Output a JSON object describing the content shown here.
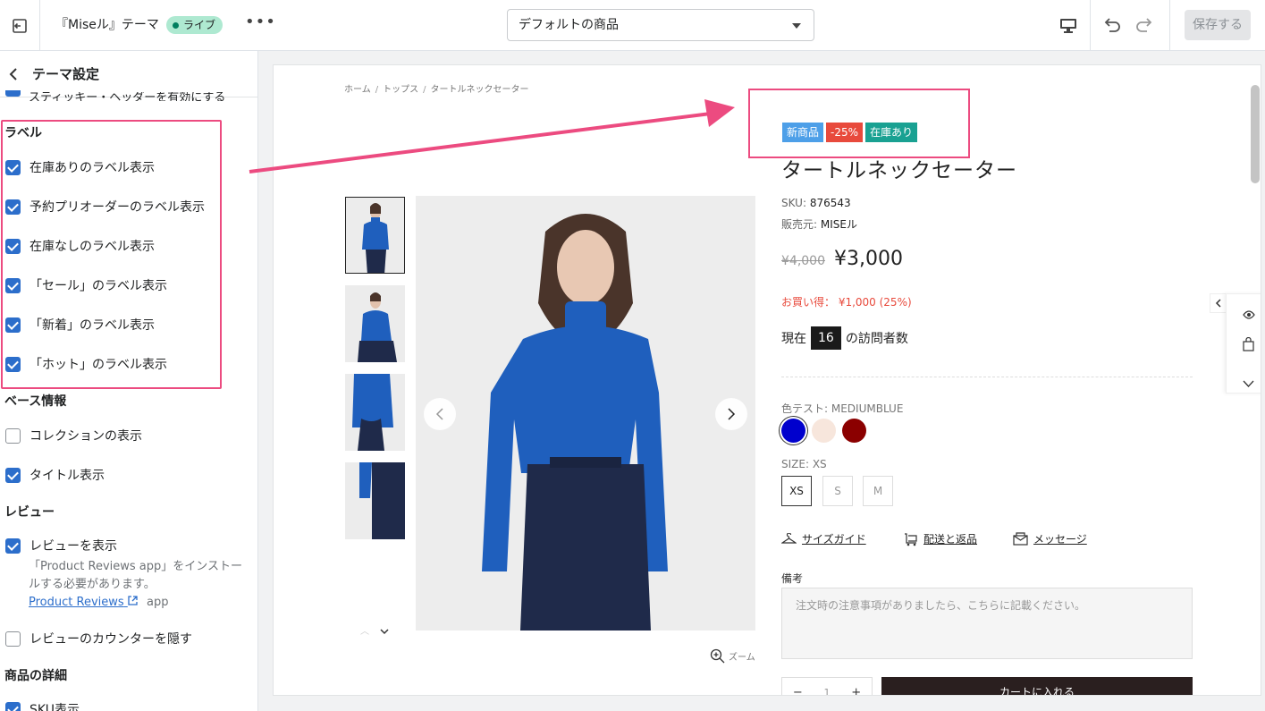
{
  "topbar": {
    "title": "『Miseル』テーマ",
    "badge": "ライブ",
    "more": "•••",
    "template_select": "デフォルトの商品",
    "save_label": "保存する"
  },
  "sidebar": {
    "title": "テーマ設定",
    "clipped_label": "スティッキー・ヘッダーを有効にする",
    "sections": {
      "label": {
        "title": "ラベル",
        "items": [
          "在庫ありのラベル表示",
          "予約プリオーダーのラベル表示",
          "在庫なしのラベル表示",
          "「セール」のラベル表示",
          "「新着」のラベル表示",
          "「ホット」のラベル表示"
        ]
      },
      "base": {
        "title": "ベース情報",
        "items": [
          "コレクションの表示",
          "タイトル表示"
        ]
      },
      "review": {
        "title": "レビュー",
        "items": [
          "レビューを表示",
          "レビューのカウンターを隠す"
        ],
        "help": "「Product Reviews app」をインストールする必要があります。",
        "link": "Product Reviews",
        "link_suffix": "app"
      },
      "detail": {
        "title": "商品の詳細",
        "items": [
          "SKU表示"
        ]
      }
    }
  },
  "product": {
    "breadcrumb": [
      "ホーム",
      "トップス",
      "タートルネックセーター"
    ],
    "badges": [
      "新商品",
      "-25%",
      "在庫あり"
    ],
    "title": "タートルネックセーター",
    "sku_label": "SKU:",
    "sku": "876543",
    "vendor_label": "販売元:",
    "vendor": "MISEル",
    "old_price": "¥4,000",
    "price": "¥3,000",
    "saving": "お買い得： ¥1,000 (25%)",
    "visitors_prefix": "現在",
    "visitors_count": "16",
    "visitors_suffix": "の訪問者数",
    "color_label": "色テスト: MEDIUMBLUE",
    "size_label": "SIZE: XS",
    "sizes": [
      "XS",
      "S",
      "M"
    ],
    "links": [
      "サイズガイド",
      "配送と返品",
      "メッセージ"
    ],
    "note_label": "備考",
    "note_placeholder": "注文時の注意事項がありましたら、こちらに記載ください。",
    "qty_minus": "−",
    "qty": "1",
    "qty_plus": "+",
    "cart": "カートに入れる",
    "zoom": "ズーム"
  },
  "colors": {
    "accent": "#2c6ecb",
    "highlight": "#ec4b80",
    "swatches": [
      "#0000cd",
      "#f7e6dc",
      "#8b0000"
    ]
  }
}
